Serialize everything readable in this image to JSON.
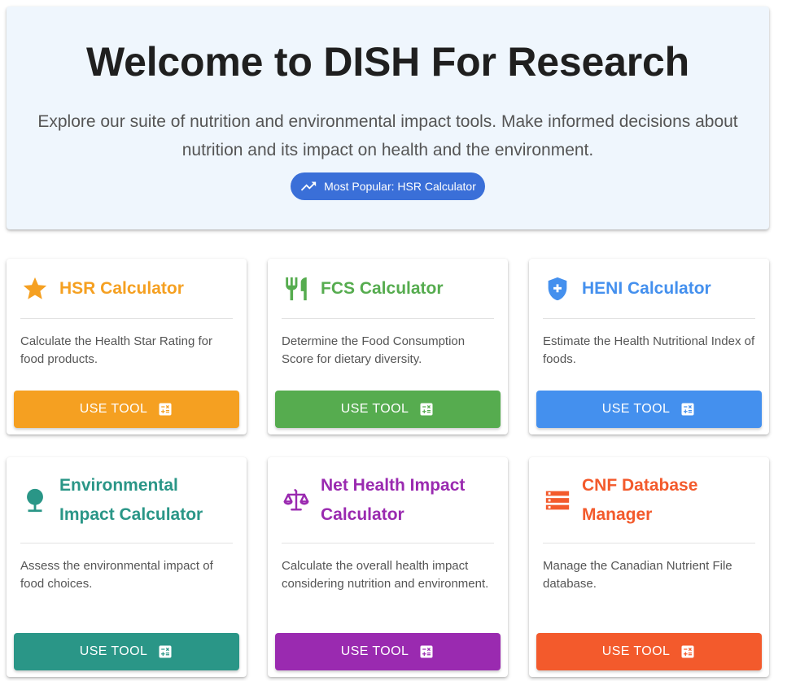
{
  "hero": {
    "title": "Welcome to DISH For Research",
    "subtitle": "Explore our suite of nutrition and environmental impact tools. Make informed decisions about nutrition and its impact on health and the environment.",
    "badge": {
      "label": "Most Popular: HSR Calculator",
      "icon": "trending-up-icon",
      "color": "#3a6fd8"
    }
  },
  "tools": [
    {
      "title": "HSR Calculator",
      "description": "Calculate the Health Star Rating for food products.",
      "button_label": "USE TOOL",
      "icon": "star-icon",
      "color": "#f5a021"
    },
    {
      "title": "FCS Calculator",
      "description": "Determine the Food Consumption Score for dietary diversity.",
      "button_label": "USE TOOL",
      "icon": "restaurant-icon",
      "color": "#56ac4f"
    },
    {
      "title": "HENI Calculator",
      "description": "Estimate the Health Nutritional Index of foods.",
      "button_label": "USE TOOL",
      "icon": "health-shield-icon",
      "color": "#4490ee"
    },
    {
      "title": "Environmental Impact Calculator",
      "description": "Assess the environmental impact of food choices.",
      "button_label": "USE TOOL",
      "icon": "tree-icon",
      "color": "#2a9687"
    },
    {
      "title": "Net Health Impact Calculator",
      "description": "Calculate the overall health impact considering nutrition and environment.",
      "button_label": "USE TOOL",
      "icon": "balance-scale-icon",
      "color": "#9a2ab0"
    },
    {
      "title": "CNF Database Manager",
      "description": "Manage the Canadian Nutrient File database.",
      "button_label": "USE TOOL",
      "icon": "storage-icon",
      "color": "#f35a2c"
    }
  ]
}
